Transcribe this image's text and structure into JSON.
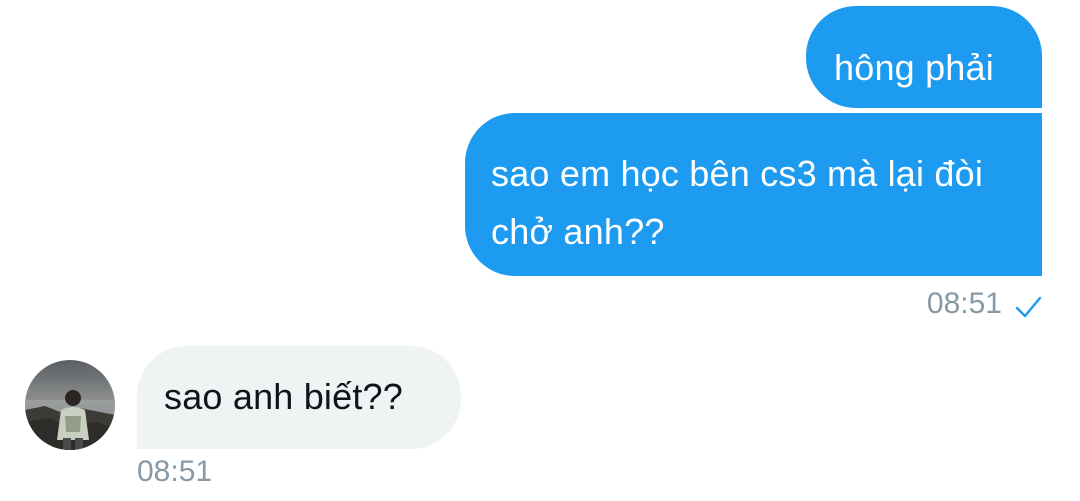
{
  "messages": [
    {
      "direction": "outgoing",
      "text": "hông phải"
    },
    {
      "direction": "outgoing",
      "text": "sao em học bên cs3 mà lại đòi chở anh??"
    },
    {
      "direction": "incoming",
      "text": "sao anh biết??"
    }
  ],
  "outgoing_timestamp": "08:51",
  "incoming_timestamp": "08:51",
  "read_receipt_icon": "checkmark-icon",
  "colors": {
    "outgoing_bubble": "#1d9bf0",
    "incoming_bubble": "#eff3f4",
    "timestamp": "#8899a6",
    "checkmark": "#1d9bf0"
  }
}
